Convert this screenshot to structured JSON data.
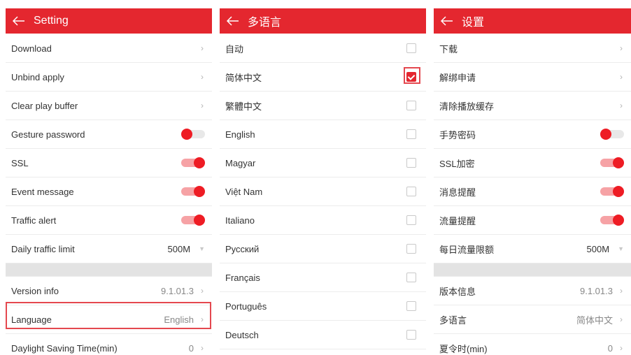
{
  "colors": {
    "accent": "#e4272f",
    "toggle_on_track": "#f6a2a5",
    "toggle_knob": "#ee1c24"
  },
  "panel_en": {
    "title": "Setting",
    "rows": [
      {
        "label": "Download",
        "type": "chevron"
      },
      {
        "label": "Unbind apply",
        "type": "chevron"
      },
      {
        "label": "Clear play buffer",
        "type": "chevron"
      },
      {
        "label": "Gesture password",
        "type": "toggle",
        "on": false
      },
      {
        "label": "SSL",
        "type": "toggle",
        "on": true
      },
      {
        "label": "Event message",
        "type": "toggle",
        "on": true
      },
      {
        "label": "Traffic alert",
        "type": "toggle",
        "on": true
      },
      {
        "label": "Daily traffic limit",
        "type": "dropdown",
        "value": "500M"
      }
    ],
    "rows2": [
      {
        "label": "Version info",
        "value": "9.1.01.3"
      },
      {
        "label": "Language",
        "value": "English"
      },
      {
        "label": "Daylight Saving Time(min)",
        "value": "0"
      }
    ]
  },
  "panel_lang": {
    "title": "多语言",
    "options": [
      {
        "label": "自动",
        "checked": false
      },
      {
        "label": "简体中文",
        "checked": true
      },
      {
        "label": "繁體中文",
        "checked": false
      },
      {
        "label": "English",
        "checked": false
      },
      {
        "label": "Magyar",
        "checked": false
      },
      {
        "label": "Việt Nam",
        "checked": false
      },
      {
        "label": "Italiano",
        "checked": false
      },
      {
        "label": "Русский",
        "checked": false
      },
      {
        "label": "Français",
        "checked": false
      },
      {
        "label": "Português",
        "checked": false
      },
      {
        "label": "Deutsch",
        "checked": false
      }
    ]
  },
  "panel_cn": {
    "title": "设置",
    "rows": [
      {
        "label": "下载",
        "type": "chevron"
      },
      {
        "label": "解绑申请",
        "type": "chevron"
      },
      {
        "label": "清除播放缓存",
        "type": "chevron"
      },
      {
        "label": "手势密码",
        "type": "toggle",
        "on": false
      },
      {
        "label": "SSL加密",
        "type": "toggle",
        "on": true
      },
      {
        "label": "消息提醒",
        "type": "toggle",
        "on": true
      },
      {
        "label": "流量提醒",
        "type": "toggle",
        "on": true
      },
      {
        "label": "每日流量限额",
        "type": "dropdown",
        "value": "500M"
      }
    ],
    "rows2": [
      {
        "label": "版本信息",
        "value": "9.1.01.3"
      },
      {
        "label": "多语言",
        "value": "简体中文"
      },
      {
        "label": "夏令时(min)",
        "value": "0"
      }
    ]
  }
}
